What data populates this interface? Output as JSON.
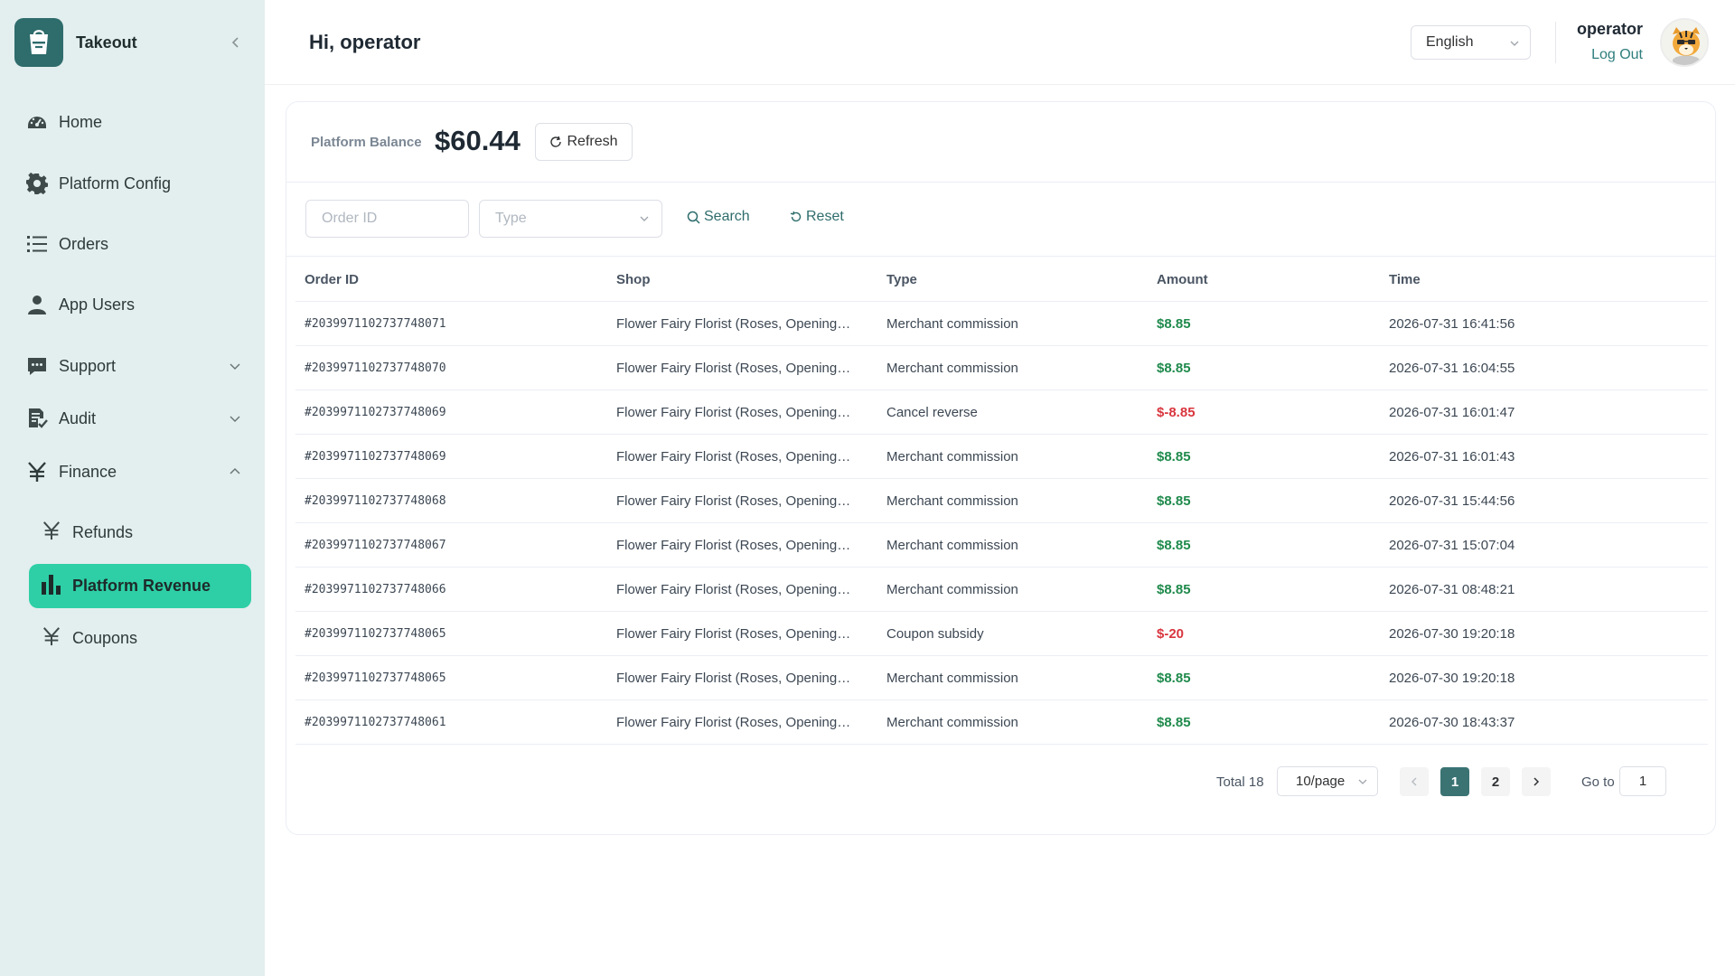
{
  "app": {
    "name": "Takeout"
  },
  "sidebar": {
    "items": [
      {
        "label": "Home",
        "icon": "dashboard-icon"
      },
      {
        "label": "Platform Config",
        "icon": "gear-icon"
      },
      {
        "label": "Orders",
        "icon": "list-icon"
      },
      {
        "label": "App Users",
        "icon": "user-icon"
      },
      {
        "label": "Support",
        "icon": "chat-icon",
        "expanded": false
      },
      {
        "label": "Audit",
        "icon": "document-check-icon",
        "expanded": false
      },
      {
        "label": "Finance",
        "icon": "yen-icon",
        "expanded": true
      }
    ],
    "finance_children": [
      {
        "label": "Refunds",
        "icon": "yen-icon",
        "active": false
      },
      {
        "label": "Platform Revenue",
        "icon": "bar-chart-icon",
        "active": true
      },
      {
        "label": "Coupons",
        "icon": "yen-icon",
        "active": false
      }
    ]
  },
  "header": {
    "greeting": "Hi, operator",
    "language": "English",
    "user_name": "operator",
    "logout_label": "Log Out"
  },
  "balance": {
    "label": "Platform Balance",
    "value": "$60.44",
    "refresh_label": "Refresh"
  },
  "filters": {
    "order_id_placeholder": "Order ID",
    "type_placeholder": "Type",
    "search_label": "Search",
    "reset_label": "Reset"
  },
  "table": {
    "columns": [
      "Order ID",
      "Shop",
      "Type",
      "Amount",
      "Time"
    ],
    "rows": [
      {
        "order_id": "#2039971102737748071",
        "shop": "Flower Fairy Florist (Roses, Opening…",
        "type": "Merchant commission",
        "amount": "$8.85",
        "positive": true,
        "time": "2026-07-31 16:41:56"
      },
      {
        "order_id": "#2039971102737748070",
        "shop": "Flower Fairy Florist (Roses, Opening…",
        "type": "Merchant commission",
        "amount": "$8.85",
        "positive": true,
        "time": "2026-07-31 16:04:55"
      },
      {
        "order_id": "#2039971102737748069",
        "shop": "Flower Fairy Florist (Roses, Opening…",
        "type": "Cancel reverse",
        "amount": "$-8.85",
        "positive": false,
        "time": "2026-07-31 16:01:47"
      },
      {
        "order_id": "#2039971102737748069",
        "shop": "Flower Fairy Florist (Roses, Opening…",
        "type": "Merchant commission",
        "amount": "$8.85",
        "positive": true,
        "time": "2026-07-31 16:01:43"
      },
      {
        "order_id": "#2039971102737748068",
        "shop": "Flower Fairy Florist (Roses, Opening…",
        "type": "Merchant commission",
        "amount": "$8.85",
        "positive": true,
        "time": "2026-07-31 15:44:56"
      },
      {
        "order_id": "#2039971102737748067",
        "shop": "Flower Fairy Florist (Roses, Opening…",
        "type": "Merchant commission",
        "amount": "$8.85",
        "positive": true,
        "time": "2026-07-31 15:07:04"
      },
      {
        "order_id": "#2039971102737748066",
        "shop": "Flower Fairy Florist (Roses, Opening…",
        "type": "Merchant commission",
        "amount": "$8.85",
        "positive": true,
        "time": "2026-07-31 08:48:21"
      },
      {
        "order_id": "#2039971102737748065",
        "shop": "Flower Fairy Florist (Roses, Opening…",
        "type": "Coupon subsidy",
        "amount": "$-20",
        "positive": false,
        "time": "2026-07-30 19:20:18"
      },
      {
        "order_id": "#2039971102737748065",
        "shop": "Flower Fairy Florist (Roses, Opening…",
        "type": "Merchant commission",
        "amount": "$8.85",
        "positive": true,
        "time": "2026-07-30 19:20:18"
      },
      {
        "order_id": "#2039971102737748061",
        "shop": "Flower Fairy Florist (Roses, Opening…",
        "type": "Merchant commission",
        "amount": "$8.85",
        "positive": true,
        "time": "2026-07-30 18:43:37"
      }
    ]
  },
  "pagination": {
    "total_label": "Total 18",
    "page_size": "10/page",
    "pages": [
      "1",
      "2"
    ],
    "current_page": "1",
    "goto_label": "Go to",
    "goto_value": "1"
  },
  "colors": {
    "accent": "#2ecfa6",
    "brand": "#2f6c6c",
    "sidebar_bg": "#e3eeee",
    "positive": "#1f8a4c",
    "negative": "#d9363e"
  }
}
